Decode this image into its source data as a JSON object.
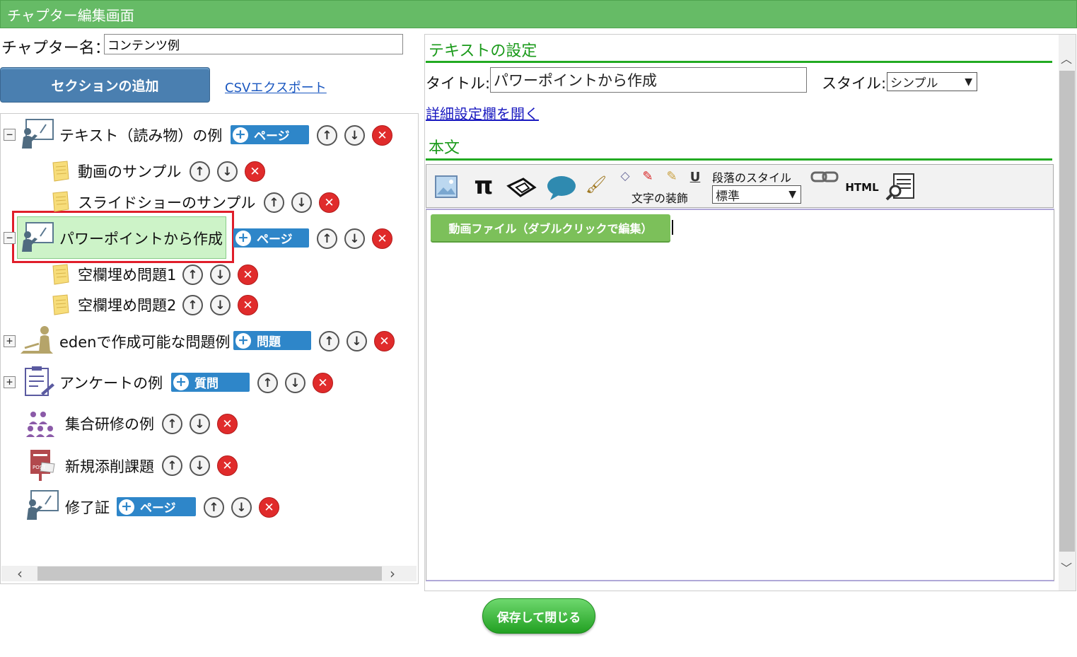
{
  "header": {
    "title": "チャプター編集画面"
  },
  "chapter": {
    "label": "チャプター名：",
    "name_value": "コンテンツ例"
  },
  "actions": {
    "add_section": "セクションの追加",
    "csv_export": "CSVエクスポート"
  },
  "tree": {
    "sections": [
      {
        "title": "テキスト（読み物）の例",
        "toggle": "−",
        "add_label": "ページ",
        "icon": "teacher-board-icon"
      },
      {
        "title": "パワーポイントから作成",
        "toggle": "−",
        "add_label": "ページ",
        "icon": "teacher-board-icon",
        "selected": true
      },
      {
        "title": "edenで作成可能な問題例",
        "toggle": "+",
        "add_label": "問題",
        "icon": "writing-person-icon"
      },
      {
        "title": "アンケートの例",
        "toggle": "+",
        "add_label": "質問",
        "icon": "clipboard-icon"
      },
      {
        "title": "集合研修の例",
        "icon": "group-training-icon"
      },
      {
        "title": "新規添削課題",
        "icon": "post-box-icon"
      },
      {
        "title": "修了証",
        "add_label": "ページ",
        "icon": "teacher-board-icon"
      }
    ],
    "pages": [
      {
        "title": "動画のサンプル",
        "icon": "note-icon"
      },
      {
        "title": "スライドショーのサンプル",
        "icon": "note-icon"
      },
      {
        "title": "空欄埋め問題1",
        "icon": "note-icon"
      },
      {
        "title": "空欄埋め問題2",
        "icon": "note-icon"
      }
    ]
  },
  "settings": {
    "heading": "テキストの設定",
    "title_label": "タイトル:",
    "title_value": "パワーポイントから作成",
    "style_label": "スタイル:",
    "style_value": "シンプル",
    "detail_link": "詳細設定欄を開く"
  },
  "body": {
    "heading": "本文",
    "decoration_label": "文字の装飾",
    "paragraph_label": "段落のスタイル",
    "paragraph_value": "標準",
    "html_label": "HTML",
    "underline_label": "U",
    "video_chip": "動画ファイル（ダブルクリックで編集）"
  },
  "footer": {
    "save_close": "保存して閉じる"
  },
  "colors": {
    "header_green": "#66bb66",
    "accent_blue": "#2e86c9",
    "delete_red": "#e02b2b",
    "heading_green": "#1a9a1a",
    "selected_border": "#e01e2a"
  }
}
